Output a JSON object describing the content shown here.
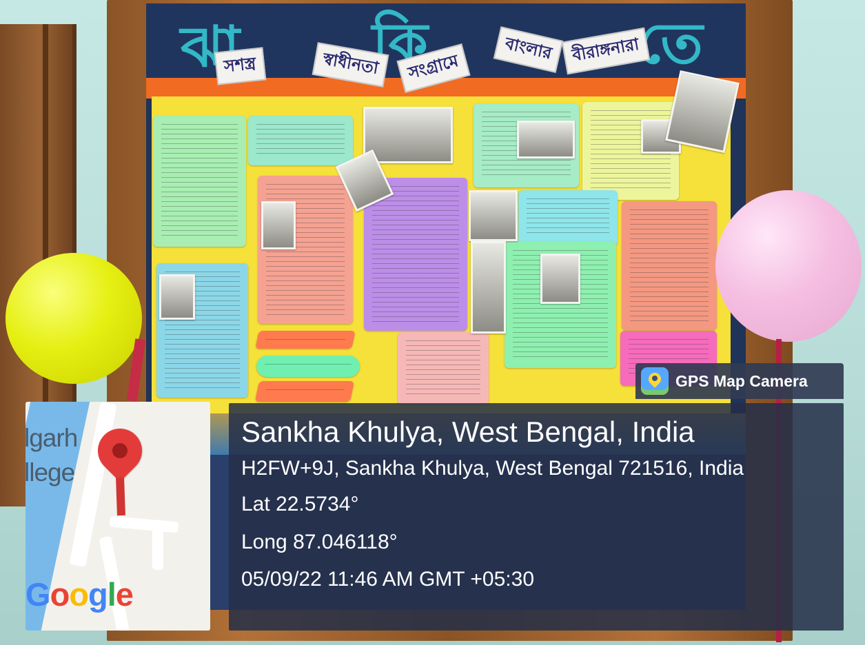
{
  "app": {
    "name": "GPS Map Camera",
    "icon": "location-camera-icon"
  },
  "location": {
    "place": "Sankha Khulya, West Bengal, India",
    "address": "H2FW+9J, Sankha Khulya, West Bengal 721516, India",
    "latitude": "Lat 22.5734°",
    "longitude": "Long 87.046118°",
    "timestamp": "05/09/22 11:46 AM GMT +05:30"
  },
  "map": {
    "label_line1": "lgarh",
    "label_line2": "llege",
    "provider": [
      "G",
      "o",
      "o",
      "g",
      "l",
      "e"
    ],
    "provider_colors": [
      "#4285F4",
      "#EA4335",
      "#FBBC05",
      "#4285F4",
      "#34A853",
      "#EA4335"
    ],
    "marker_icon": "map-pin-icon"
  },
  "board_text": {
    "word1": "সশস্ত্র",
    "word2": "স্বাধীনতা",
    "word3": "সংগ্রামে",
    "word4": "বাংলার",
    "word5": "বীরাঙ্গনারা",
    "big1": "ঝা",
    "big2": "কি",
    "big3": "তে"
  }
}
